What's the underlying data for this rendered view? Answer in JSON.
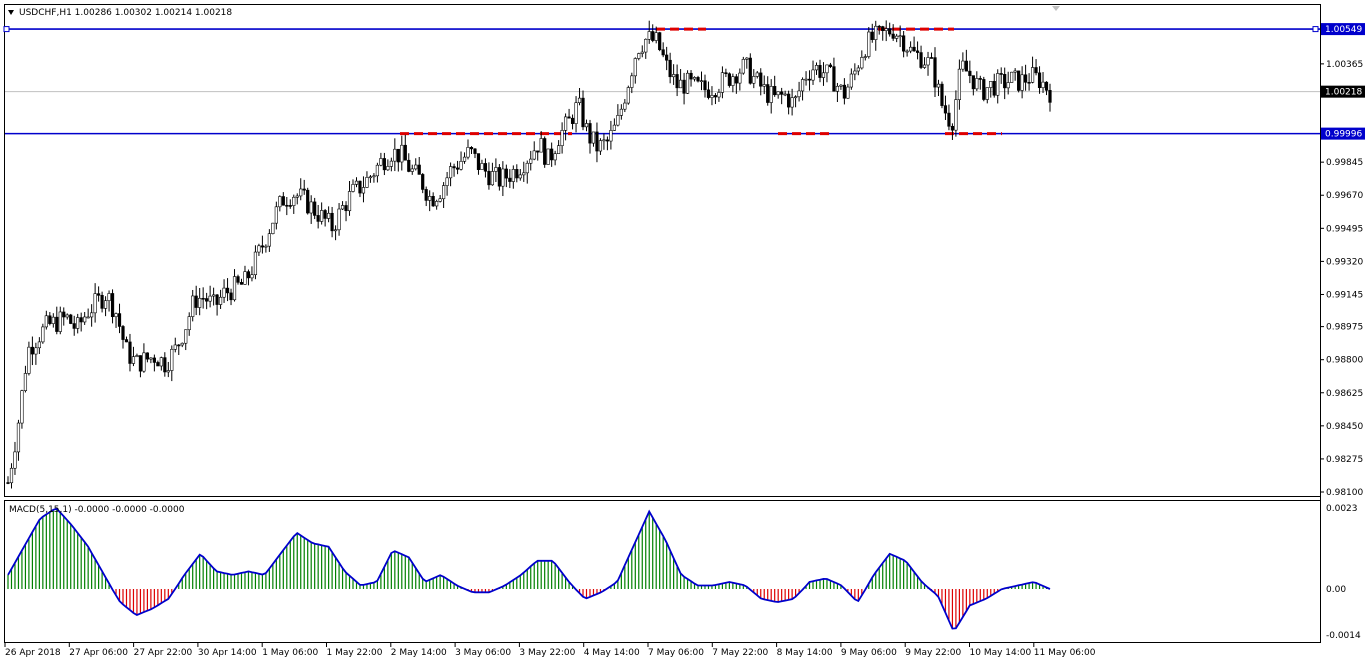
{
  "header": {
    "symbol_text": "USDCHF,H1  1.00286 1.00302 1.00214 1.00218",
    "menu_icon": "triangle-down-icon"
  },
  "price_axis": {
    "ticks": [
      "1.00549",
      "1.00365",
      "1.00218",
      "0.99996",
      "0.99845",
      "0.99670",
      "0.99495",
      "0.99320",
      "0.99145",
      "0.98975",
      "0.98800",
      "0.98625",
      "0.98450",
      "0.98275",
      "0.98100"
    ],
    "current_price": "1.00218",
    "resistance_label": "1.00549",
    "support_label": "0.99996"
  },
  "time_axis": {
    "ticks": [
      "26 Apr 2018",
      "27 Apr 06:00",
      "27 Apr 22:00",
      "30 Apr 14:00",
      "1 May 06:00",
      "1 May 22:00",
      "2 May 14:00",
      "3 May 06:00",
      "3 May 22:00",
      "4 May 14:00",
      "7 May 06:00",
      "7 May 22:00",
      "8 May 14:00",
      "9 May 06:00",
      "9 May 22:00",
      "10 May 14:00",
      "11 May 06:00"
    ]
  },
  "macd": {
    "label": "MACD(5,15,1) -0.0000 -0.0000 -0.0000",
    "ticks": [
      "0.0023",
      "0.00",
      "-0.0014"
    ]
  },
  "colors": {
    "level_line": "#0000cc",
    "marker": "#dd0000",
    "candle": "#000000",
    "macd_positive": "#008000",
    "macd_negative": "#dd0000",
    "macd_signal": "#0000cc"
  },
  "chart_data": {
    "type": "candlestick",
    "symbol": "USDCHF",
    "timeframe": "H1",
    "ylim": [
      0.981,
      1.0065
    ],
    "levels": [
      1.00549,
      0.99996
    ],
    "current": 1.00218,
    "close_path": [
      0.9815,
      0.9845,
      0.9885,
      0.9892,
      0.9898,
      0.99,
      0.9902,
      0.9896,
      0.9905,
      0.991,
      0.9915,
      0.9905,
      0.9885,
      0.9878,
      0.988,
      0.9882,
      0.9878,
      0.9885,
      0.9897,
      0.9912,
      0.9913,
      0.9908,
      0.9915,
      0.9918,
      0.992,
      0.993,
      0.9942,
      0.9955,
      0.9965,
      0.9968,
      0.9965,
      0.996,
      0.9955,
      0.995,
      0.996,
      0.9968,
      0.9972,
      0.9978,
      0.9985,
      0.999,
      0.9988,
      0.998,
      0.9975,
      0.9965,
      0.997,
      0.998,
      0.9985,
      0.999,
      0.9982,
      0.9978,
      0.9975,
      0.9978,
      0.9982,
      0.9988,
      0.9995,
      0.9985,
      0.9998,
      1.0005,
      1.0015,
      0.9999,
      0.9992,
      0.9995,
      1.0005,
      1.0025,
      1.0045,
      1.005,
      1.0048,
      1.0035,
      1.0025,
      1.0026,
      1.0024,
      1.0023,
      1.0025,
      1.0028,
      1.0032,
      1.0035,
      1.0028,
      1.0022,
      1.0018,
      1.002,
      1.0015,
      1.003,
      1.0035,
      1.0032,
      1.0028,
      1.002,
      1.003,
      1.0045,
      1.005,
      1.0052,
      1.0055,
      1.005,
      1.0042,
      1.004,
      1.0035,
      1.0015,
      1.0005,
      1.0035,
      1.003,
      1.0022,
      1.0025,
      1.0026,
      1.0028,
      1.0027,
      1.003,
      1.0028,
      1.0022
    ],
    "macd_values": [
      0.0004,
      0.0012,
      0.002,
      0.0023,
      0.0018,
      0.0012,
      0.0004,
      -0.0004,
      -0.0008,
      -0.0006,
      -0.0003,
      0.0004,
      0.001,
      0.0005,
      0.0004,
      0.0005,
      0.0004,
      0.001,
      0.0016,
      0.0013,
      0.0012,
      0.0005,
      0.0001,
      0.0002,
      0.0011,
      0.0009,
      0.0002,
      0.0004,
      0.0001,
      -0.0001,
      -0.0001,
      0.0001,
      0.0004,
      0.0008,
      0.0008,
      0.0002,
      -0.0003,
      -0.0001,
      0.0002,
      0.0012,
      0.0022,
      0.0014,
      0.0004,
      0.0001,
      0.0001,
      0.0002,
      0.0001,
      -0.0003,
      -0.0004,
      -0.0003,
      0.0002,
      0.0003,
      0.0001,
      -0.0004,
      0.0004,
      0.001,
      0.0008,
      0.0002,
      -0.0002,
      -0.0013,
      -0.0005,
      -0.0003,
      0.0,
      0.0001,
      0.0002,
      0.0
    ]
  }
}
